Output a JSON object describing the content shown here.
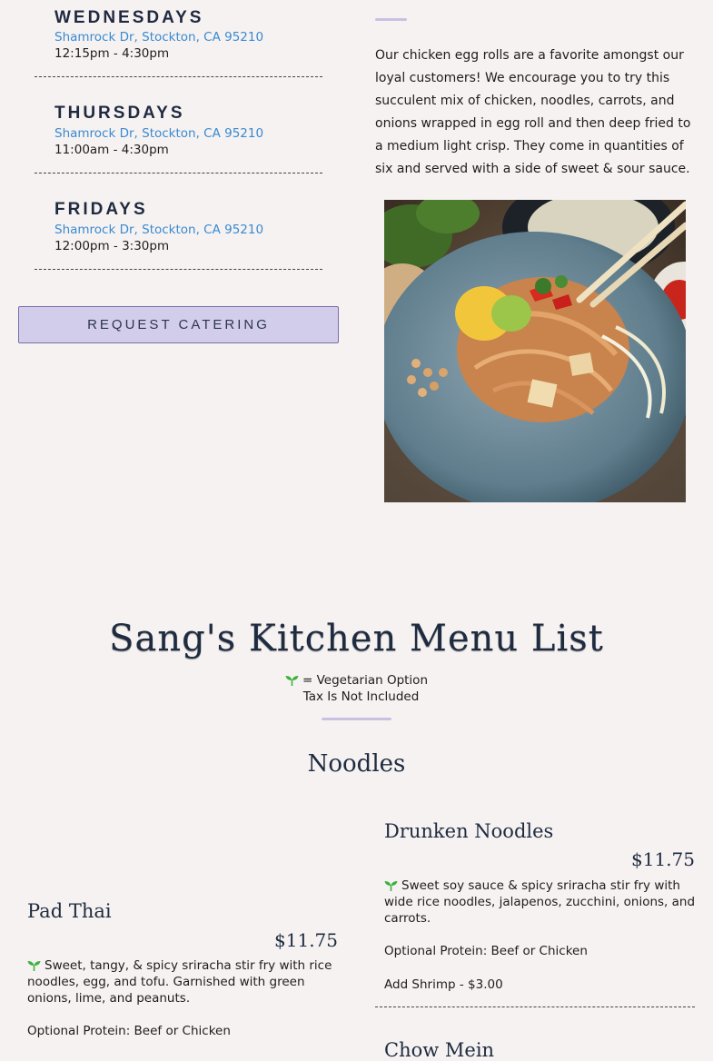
{
  "schedule": [
    {
      "day": "WEDNESDAYS",
      "address": "Shamrock Dr, Stockton, CA 95210",
      "hours": "12:15pm - 4:30pm"
    },
    {
      "day": "THURSDAYS",
      "address": "Shamrock Dr, Stockton, CA 95210",
      "hours": "11:00am - 4:30pm"
    },
    {
      "day": "FRIDAYS",
      "address": "Shamrock Dr, Stockton, CA 95210",
      "hours": "12:00pm - 3:30pm"
    }
  ],
  "catering_button": "REQUEST CATERING",
  "egg_roll_description": "Our chicken egg rolls are a favorite amongst our loyal customers! We encourage you to try this succulent mix of chicken, noodles, carrots, and onions wrapped in egg roll and then deep fried to a medium light crisp. They come in quantities of six and served with a side of sweet & sour sauce.",
  "menu": {
    "title": "Sang's Kitchen Menu List",
    "veg_legend": "= Vegetarian Option",
    "tax_note": "Tax Is Not Included",
    "section": "Noodles",
    "items": [
      {
        "name": "Drunken Noodles",
        "price": "$11.75",
        "description": "Sweet soy sauce & spicy sriracha stir fry with wide rice noodles, jalapenos, zucchini, onions, and carrots.",
        "protein": "Optional Protein: Beef or Chicken",
        "addon": "Add Shrimp - $3.00"
      },
      {
        "name": "Pad Thai",
        "price": "$11.75",
        "description": "Sweet, tangy, & spicy sriracha stir fry with rice noodles, egg, and tofu. Garnished with green onions, lime, and peanuts.",
        "protein": "Optional Protein: Beef or Chicken"
      },
      {
        "name": "Chow Mein"
      }
    ]
  },
  "icons": {
    "vegetarian": "sprout-icon"
  },
  "colors": {
    "accent": "#c9c0e3",
    "link": "#3a8ad0",
    "button_bg": "#d3cdec",
    "heading": "#1e2b40",
    "leaf": "#3cb23c"
  }
}
